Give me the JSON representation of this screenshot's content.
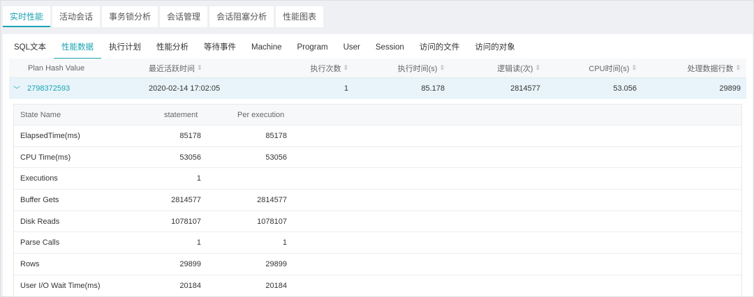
{
  "top_tabs": [
    {
      "label": "实时性能"
    },
    {
      "label": "活动会话"
    },
    {
      "label": "事务锁分析"
    },
    {
      "label": "会话管理"
    },
    {
      "label": "会话阻塞分析"
    },
    {
      "label": "性能图表"
    }
  ],
  "sub_tabs": [
    {
      "label": "SQL文本"
    },
    {
      "label": "性能数据"
    },
    {
      "label": "执行计划"
    },
    {
      "label": "性能分析"
    },
    {
      "label": "等待事件"
    },
    {
      "label": "Machine"
    },
    {
      "label": "Program"
    },
    {
      "label": "User"
    },
    {
      "label": "Session"
    },
    {
      "label": "访问的文件"
    },
    {
      "label": "访问的对象"
    }
  ],
  "main_table": {
    "headers": [
      "Plan Hash Value",
      "最近活跃时间",
      "执行次数",
      "执行时间(s)",
      "逻辑读(次)",
      "CPU时间(s)",
      "处理数据行数"
    ],
    "row": {
      "plan_hash": "2798372593",
      "last_active": "2020-02-14 17:02:05",
      "executions": "1",
      "exec_time": "85.178",
      "logical_reads": "2814577",
      "cpu_time": "53.056",
      "rows_processed": "29899"
    }
  },
  "detail_table": {
    "headers": [
      "State Name",
      "statement",
      "Per execution"
    ],
    "rows": [
      {
        "name": "ElapsedTime(ms)",
        "statement": "85178",
        "per_exec": "85178"
      },
      {
        "name": "CPU Time(ms)",
        "statement": "53056",
        "per_exec": "53056"
      },
      {
        "name": "Executions",
        "statement": "1",
        "per_exec": ""
      },
      {
        "name": "Buffer Gets",
        "statement": "2814577",
        "per_exec": "2814577"
      },
      {
        "name": "Disk Reads",
        "statement": "1078107",
        "per_exec": "1078107"
      },
      {
        "name": "Parse Calls",
        "statement": "1",
        "per_exec": "1"
      },
      {
        "name": "Rows",
        "statement": "29899",
        "per_exec": "29899"
      },
      {
        "name": "User I/O Wait Time(ms)",
        "statement": "20184",
        "per_exec": "20184"
      }
    ]
  },
  "colors": {
    "accent": "#1aa3b3",
    "row_highlight": "#e8f4fa"
  }
}
